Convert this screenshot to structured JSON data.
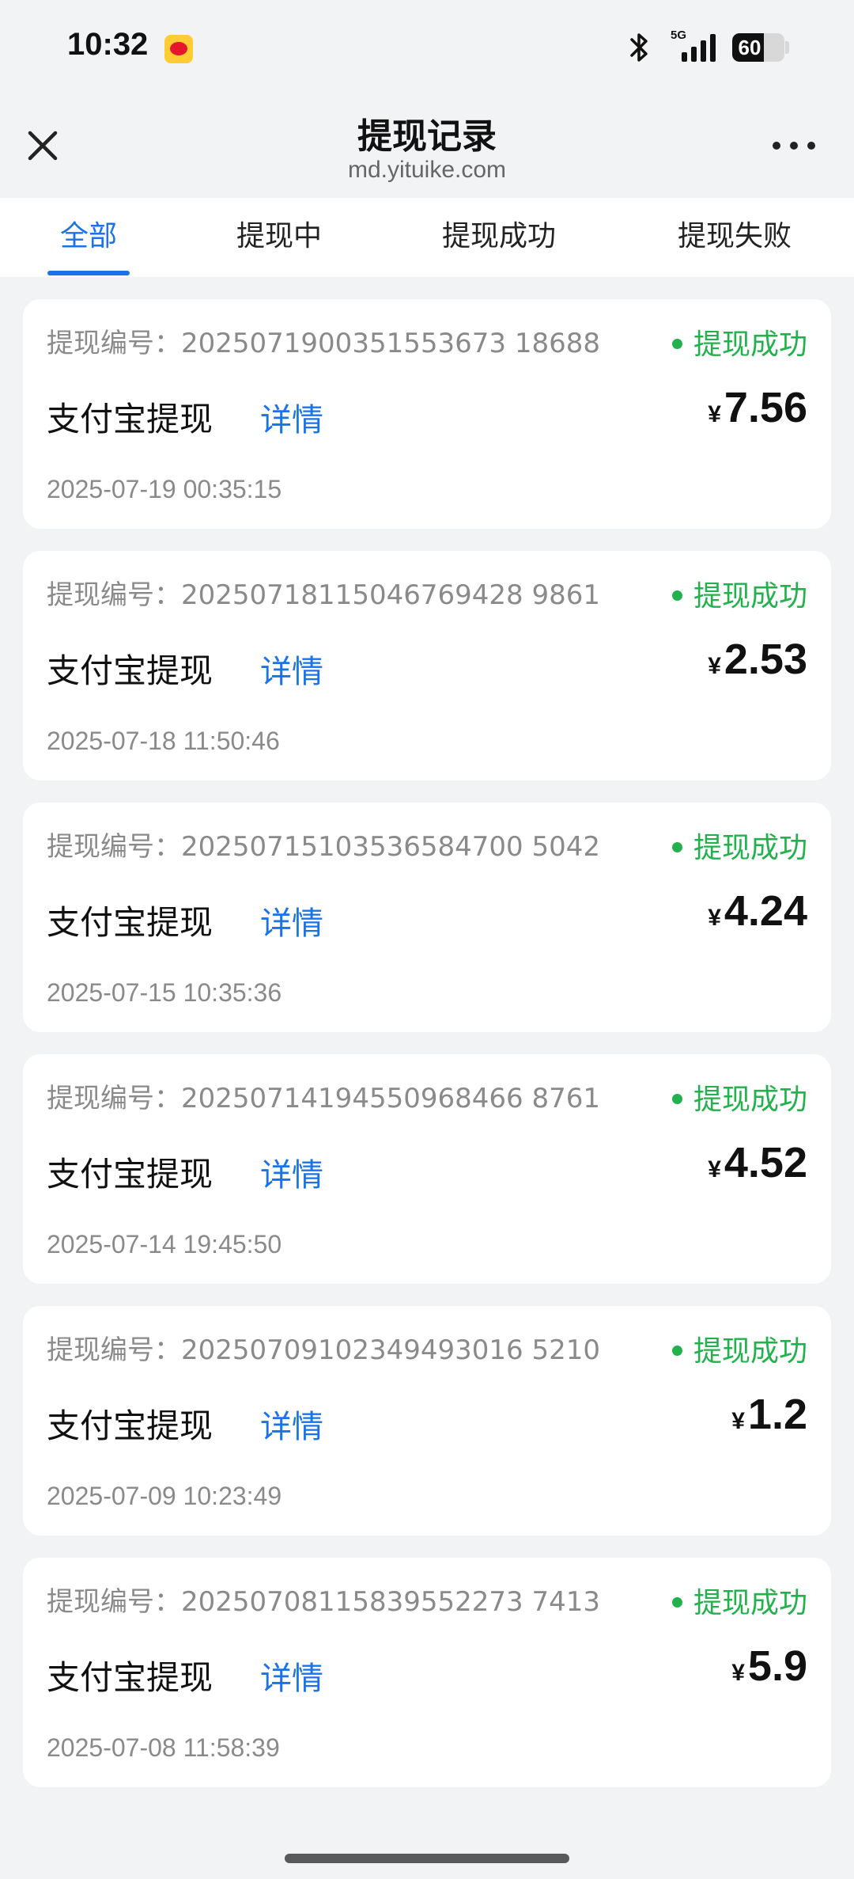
{
  "status_bar": {
    "time": "10:32",
    "network": "5G",
    "battery": "60",
    "battery_level_percent": 60
  },
  "nav": {
    "title": "提现记录",
    "subtitle": "md.yituike.com"
  },
  "tabs": [
    {
      "label": "全部",
      "active": true
    },
    {
      "label": "提现中",
      "active": false
    },
    {
      "label": "提现成功",
      "active": false
    },
    {
      "label": "提现失败",
      "active": false
    }
  ],
  "records": [
    {
      "order_label": "提现编号：",
      "order_no": "2025071900351553673 18688",
      "status": "提现成功",
      "type": "支付宝提现",
      "detail": "详情",
      "currency": "¥",
      "amount": "7.56",
      "time": "2025-07-19 00:35:15"
    },
    {
      "order_label": "提现编号：",
      "order_no": "20250718115046769428 9861",
      "status": "提现成功",
      "type": "支付宝提现",
      "detail": "详情",
      "currency": "¥",
      "amount": "2.53",
      "time": "2025-07-18 11:50:46"
    },
    {
      "order_label": "提现编号：",
      "order_no": "20250715103536584700 5042",
      "status": "提现成功",
      "type": "支付宝提现",
      "detail": "详情",
      "currency": "¥",
      "amount": "4.24",
      "time": "2025-07-15 10:35:36"
    },
    {
      "order_label": "提现编号：",
      "order_no": "20250714194550968466 8761",
      "status": "提现成功",
      "type": "支付宝提现",
      "detail": "详情",
      "currency": "¥",
      "amount": "4.52",
      "time": "2025-07-14 19:45:50"
    },
    {
      "order_label": "提现编号：",
      "order_no": "20250709102349493016 5210",
      "status": "提现成功",
      "type": "支付宝提现",
      "detail": "详情",
      "currency": "¥",
      "amount": "1.2",
      "time": "2025-07-09 10:23:49"
    },
    {
      "order_label": "提现编号：",
      "order_no": "20250708115839552273 7413",
      "status": "提现成功",
      "type": "支付宝提现",
      "detail": "详情",
      "currency": "¥",
      "amount": "5.9",
      "time": "2025-07-08 11:58:39"
    }
  ],
  "colors": {
    "accent": "#1a73e8",
    "success": "#22b14c",
    "background": "#f2f3f5"
  },
  "icons": {
    "close": "close-icon",
    "more": "more-icon",
    "bluetooth": "bluetooth-icon",
    "signal": "signal-icon",
    "battery": "battery-icon",
    "app_notification": "weibo-icon"
  }
}
